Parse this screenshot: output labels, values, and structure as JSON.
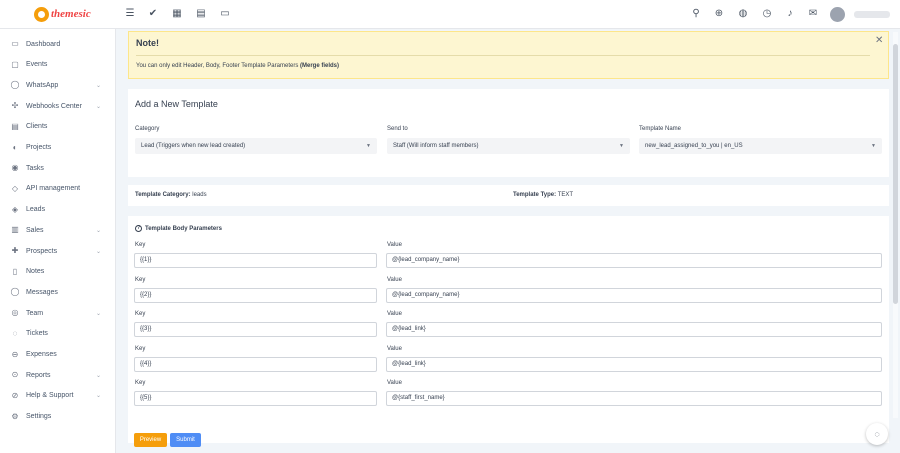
{
  "brand": {
    "name": "themesic",
    "accent": "#f59e0b",
    "name_color": "#ef4444"
  },
  "topbar": {
    "left_icons": [
      "menu-icon",
      "check-circle-icon",
      "grid-icon",
      "briefcase-icon",
      "monitor-icon"
    ],
    "right_icons": [
      "search-icon",
      "plus-circle-icon",
      "globe-icon",
      "clock-icon",
      "bell-icon",
      "mail-icon"
    ]
  },
  "sidebar": {
    "items": [
      {
        "label": "Dashboard",
        "icon": "dashboard-icon",
        "has_children": false
      },
      {
        "label": "Events",
        "icon": "calendar-icon",
        "has_children": false
      },
      {
        "label": "WhatsApp",
        "icon": "chat-icon",
        "has_children": true
      },
      {
        "label": "Webhooks Center",
        "icon": "webhook-icon",
        "has_children": true
      },
      {
        "label": "Clients",
        "icon": "clients-icon",
        "has_children": false
      },
      {
        "label": "Projects",
        "icon": "projects-icon",
        "has_children": false
      },
      {
        "label": "Tasks",
        "icon": "tasks-icon",
        "has_children": false
      },
      {
        "label": "API management",
        "icon": "tag-icon",
        "has_children": false
      },
      {
        "label": "Leads",
        "icon": "leads-icon",
        "has_children": false
      },
      {
        "label": "Sales",
        "icon": "sales-icon",
        "has_children": true
      },
      {
        "label": "Prospects",
        "icon": "prospects-icon",
        "has_children": true
      },
      {
        "label": "Notes",
        "icon": "notes-icon",
        "has_children": false
      },
      {
        "label": "Messages",
        "icon": "messages-icon",
        "has_children": false
      },
      {
        "label": "Team",
        "icon": "team-icon",
        "has_children": true
      },
      {
        "label": "Tickets",
        "icon": "tickets-icon",
        "has_children": false
      },
      {
        "label": "Expenses",
        "icon": "expenses-icon",
        "has_children": false
      },
      {
        "label": "Reports",
        "icon": "reports-icon",
        "has_children": true
      },
      {
        "label": "Help & Support",
        "icon": "help-icon",
        "has_children": true
      },
      {
        "label": "Settings",
        "icon": "settings-icon",
        "has_children": false
      }
    ]
  },
  "note": {
    "title": "Note!",
    "text_prefix": "You can only edit Header, Body, Footer Template Parameters ",
    "text_bold": "(Merge fields)",
    "close_icon": "close-icon"
  },
  "form": {
    "title": "Add a New Template",
    "category": {
      "label": "Category",
      "value": "Lead (Triggers when new lead created)"
    },
    "send_to": {
      "label": "Send to",
      "value": "Staff (Will inform staff members)"
    },
    "template_name": {
      "label": "Template Name",
      "value": "new_lead_assigned_to_you | en_US"
    }
  },
  "template_info": {
    "category_label": "Template Category:",
    "category_value": "leads",
    "type_label": "Template Type:",
    "type_value": "TEXT"
  },
  "body_params": {
    "title": "Template Body Parameters",
    "key_label": "Key",
    "value_label": "Value",
    "rows": [
      {
        "key": "{{1}}",
        "value": "@{lead_company_name}"
      },
      {
        "key": "{{2}}",
        "value": "@{lead_company_name}"
      },
      {
        "key": "{{3}}",
        "value": "@{lead_link}"
      },
      {
        "key": "{{4}}",
        "value": "@{lead_link}"
      },
      {
        "key": "{{5}}",
        "value": "@{staff_first_name}"
      }
    ]
  },
  "actions": {
    "preview_label": "Preview",
    "submit_label": "Submit",
    "preview_color": "#f59e0b",
    "submit_color": "#4f8df5"
  }
}
